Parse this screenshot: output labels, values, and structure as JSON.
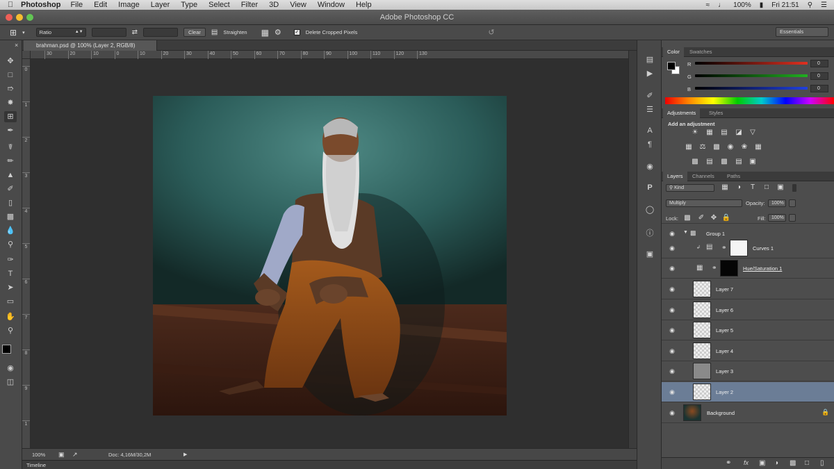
{
  "menubar": {
    "app_name": "Photoshop",
    "items": [
      "File",
      "Edit",
      "Image",
      "Layer",
      "Type",
      "Select",
      "Filter",
      "3D",
      "View",
      "Window",
      "Help"
    ],
    "battery": "100%",
    "clock": "Fri 21:51"
  },
  "window": {
    "title": "Adobe Photoshop CC"
  },
  "options": {
    "ratio_label": "Ratio",
    "clear_label": "Clear",
    "straighten_label": "Straighten",
    "delete_cropped_label": "Delete Cropped Pixels",
    "delete_cropped_checked": true,
    "workspace": "Essentials"
  },
  "document": {
    "tab_title": "brahman.psd @ 100% (Layer 2, RGB/8)",
    "ruler_h": [
      "30",
      "20",
      "10",
      "0",
      "10",
      "20",
      "30",
      "40",
      "50",
      "60",
      "70",
      "80",
      "90",
      "100",
      "110",
      "120",
      "130"
    ],
    "ruler_v": [
      "0",
      "1",
      "2",
      "3",
      "4",
      "5",
      "6",
      "7",
      "8",
      "9",
      "1"
    ]
  },
  "status": {
    "zoom": "100%",
    "doc_size": "Doc: 4,16M/30,2M"
  },
  "timeline": {
    "label": "Timeline"
  },
  "color_panel": {
    "tabs": [
      "Color",
      "Swatches"
    ],
    "channels": [
      {
        "label": "R",
        "value": "0"
      },
      {
        "label": "G",
        "value": "0"
      },
      {
        "label": "B",
        "value": "0"
      }
    ]
  },
  "adjustments_panel": {
    "tabs": [
      "Adjustments",
      "Styles"
    ],
    "heading": "Add an adjustment"
  },
  "layers_panel": {
    "tabs": [
      "Layers",
      "Channels",
      "Paths"
    ],
    "filter_kind": "Kind",
    "blend_mode": "Multiply",
    "opacity_label": "Opacity:",
    "opacity_value": "100%",
    "lock_label": "Lock:",
    "fill_label": "Fill:",
    "fill_value": "100%",
    "layers": [
      {
        "name": "Group 1",
        "type": "group"
      },
      {
        "name": "Curves 1",
        "type": "adjustment"
      },
      {
        "name": "Hue/Saturation 1",
        "type": "adjustment"
      },
      {
        "name": "Layer 7",
        "type": "pixel"
      },
      {
        "name": "Layer 6",
        "type": "pixel"
      },
      {
        "name": "Layer 5",
        "type": "pixel"
      },
      {
        "name": "Layer 4",
        "type": "pixel"
      },
      {
        "name": "Layer 3",
        "type": "pixel"
      },
      {
        "name": "Layer 2",
        "type": "pixel",
        "selected": true
      },
      {
        "name": "Background",
        "type": "background",
        "locked": true
      }
    ]
  }
}
